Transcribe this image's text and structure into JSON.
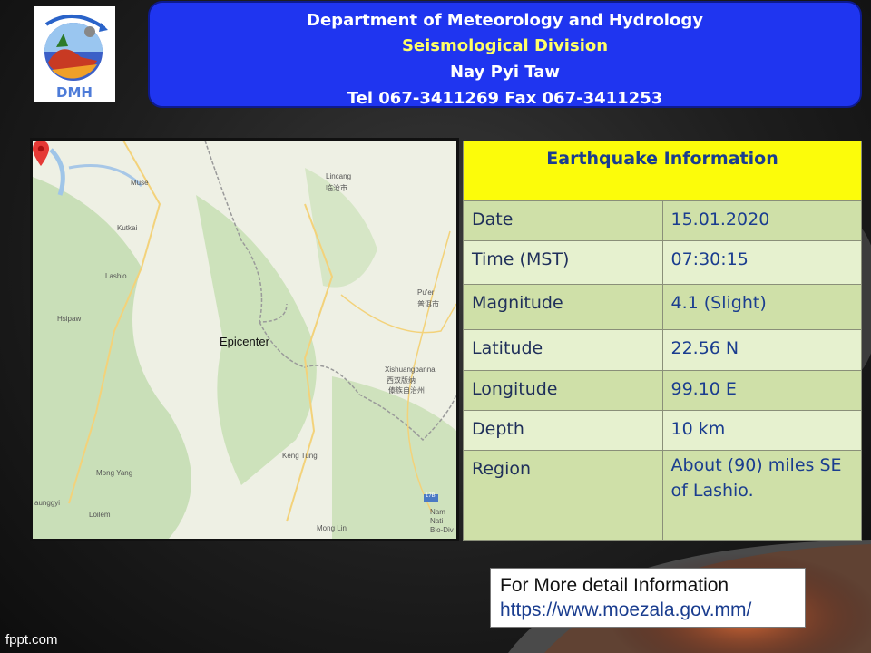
{
  "header": {
    "logo_text": "DMH",
    "line1": "Department of Meteorology and Hydrology",
    "line2": "Seismological  Division",
    "line3": "Nay Pyi Taw",
    "line4": "Tel 067-3411269  Fax 067-3411253"
  },
  "map": {
    "epicenter_label": "Epicenter",
    "places": [
      "Muse",
      "Lincang",
      "Kutkai",
      "Lashio",
      "Hsipaw",
      "Pu'er",
      "Xishuangbanna",
      "Keng Tung",
      "Mong Yang",
      "Loilem",
      "aunggyi",
      "Mong Lin",
      "Nam",
      "Nati",
      "Bio-Div",
      "17B"
    ],
    "chinese_labels": [
      "临沧市",
      "普洱市",
      "西双版纳",
      "傣族自治州"
    ]
  },
  "table": {
    "title": "Earthquake Information",
    "rows": [
      {
        "label": "Date",
        "value": "15.01.2020"
      },
      {
        "label": "Time (MST)",
        "value": "07:30:15"
      },
      {
        "label": "Magnitude",
        "value": "4.1 (Slight)"
      },
      {
        "label": "Latitude",
        "value": "22.56 N"
      },
      {
        "label": "Longitude",
        "value": "99.10 E"
      },
      {
        "label": "Depth",
        "value": "10 km"
      },
      {
        "label": "Region",
        "value": "About (90) miles SE of Lashio."
      }
    ]
  },
  "info": {
    "line1": "For More detail Information",
    "url": "https://www.moezala.gov.mm/"
  },
  "footer": "fppt.com",
  "colors": {
    "header_bg": "#1f35f0",
    "header_highlight": "#ffff66",
    "table_title_bg": "#fcfc0a",
    "row_dark": "#cfe0a8",
    "row_light": "#e6f1cf",
    "value_text": "#1a3d8f"
  }
}
